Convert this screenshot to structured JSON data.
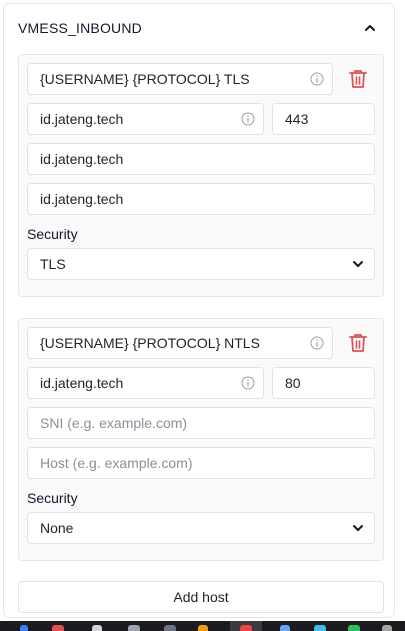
{
  "panel": {
    "title": "VMESS_INBOUND",
    "collapse_icon": "chevron-up-icon"
  },
  "hosts": [
    {
      "remark": "{USERNAME} {PROTOCOL} TLS",
      "address": "id.jateng.tech",
      "port": "443",
      "sni": "id.jateng.tech",
      "host": "id.jateng.tech",
      "security_label": "Security",
      "security_value": "TLS"
    },
    {
      "remark": "{USERNAME} {PROTOCOL} NTLS",
      "address": "id.jateng.tech",
      "port": "80",
      "sni_placeholder": "SNI (e.g. example.com)",
      "host_placeholder": "Host (e.g. example.com)",
      "security_label": "Security",
      "security_value": "None"
    }
  ],
  "add_host_label": "Add host",
  "colors": {
    "delete_red": "#e05252",
    "border": "#dfe2e6",
    "card_bg": "#fafafa"
  }
}
